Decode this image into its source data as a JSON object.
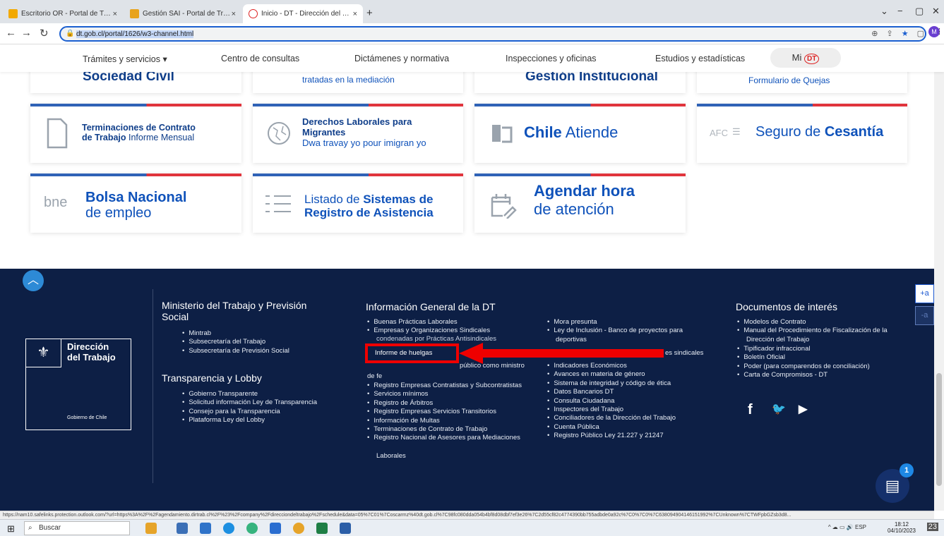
{
  "browser": {
    "tabs": [
      {
        "title": "Escritorio OR - Portal de Transpa",
        "color": "#f2a900"
      },
      {
        "title": "Gestión SAI - Portal de Transpar",
        "color": "#e8a31c"
      },
      {
        "title": "Inicio - DT - Dirección del Trabaj",
        "color": "#d22"
      }
    ],
    "url": "dt.gob.cl/portal/1626/w3-channel.html",
    "profile_initial": "M"
  },
  "topnav": {
    "items": [
      "Trámites y servicios ▾",
      "Centro de consultas",
      "Dictámenes y normativa",
      "Inspecciones y oficinas",
      "Estudios y estadísticas"
    ],
    "mi": "Mi",
    "dt": "DT"
  },
  "cards": {
    "row0": {
      "a": "Sociedad Civil",
      "b": "tratadas en la mediación",
      "c": "Gestión Institucional",
      "d": "Formulario de Quejas"
    },
    "row1": {
      "terminaciones_bold": "Terminaciones de Contrato",
      "terminaciones_bold2": "de Trabajo",
      "terminaciones_rest": " Informe Mensual",
      "derechos_1": "Derechos Laborales para",
      "derechos_2": "Migrantes",
      "derechos_3": "Dwa travay yo pour imigran yo",
      "chile_bold": "Chile",
      "chile_rest": " Atiende",
      "afc": "AFC",
      "seguro_1": "Seguro de ",
      "seguro_2": "Cesantía"
    },
    "row2": {
      "bne": "bne",
      "bolsa_1": "Bolsa Nacional",
      "bolsa_2": "de empleo",
      "listado_1": "Listado de ",
      "listado_2": "Sistemas de",
      "listado_3": "Registro de Asistencia",
      "agendar_1": "Agendar hora",
      "agendar_2": "de atención"
    }
  },
  "footer": {
    "logo_1": "Dirección",
    "logo_2": "del Trabajo",
    "logo_3": "Gobierno de Chile",
    "ministerio_title_1": "Ministerio del Trabajo y Previsión",
    "ministerio_title_2": "Social",
    "ministerio_links": [
      "Mintrab",
      "Subsecretaría del Trabajo",
      "Subsecretaría de Previsión Social"
    ],
    "transparencia_title": "Transparencia y Lobby",
    "transparencia_links": [
      "Gobierno Transparente",
      "Solicitud información Ley de Transparencia",
      "Consejo para la Transparencia",
      "Plataforma Ley del Lobby"
    ],
    "info_title": "Información General de la DT",
    "info_col1": [
      "Buenas Prácticas Laborales",
      "Empresas y Organizaciones Sindicales"
    ],
    "info_col1_hidden": "condenadas por Prácticas Antisindicales",
    "informe": "Informe de huelgas",
    "publico_tail": "público como ministro",
    "de_fe": "de fe",
    "info_col1_rest": [
      "Registro Empresas Contratistas y Subcontratistas",
      "Servicios mínimos",
      "Registro de Árbitros",
      "Registro Empresas Servicios Transitorios",
      "Información de Multas",
      "Terminaciones de Contrato de Trabajo",
      "Registro Nacional de Asesores para Mediaciones"
    ],
    "laborales": "Laborales",
    "info_col2a": [
      "Mora presunta",
      "Ley de Inclusión - Banco de proyectos para"
    ],
    "deportivas": "deportivas",
    "sindicales_tail": "es sindicales",
    "info_col2b": [
      "Indicadores Económicos",
      "Avances en materia de género",
      "Sistema de integridad y código de ética",
      "Datos Bancarios DT",
      "Consulta Ciudadana",
      "Inspectores del Trabajo",
      "Conciliadores de la Dirección del Trabajo",
      "Cuenta Pública",
      "Registro Público Ley 21.227 y 21247"
    ],
    "docs_title": "Documentos de interés",
    "docs_links": [
      "Modelos de Contrato",
      "Manual del Procedimiento de Fiscalización de la",
      "Tipificador infraccional",
      "Boletín Oficial",
      "Poder (para comparendos de conciliación)",
      "Carta de Compromisos - DT"
    ],
    "docs_cont": "Dirección del Trabajo",
    "social": [
      "f",
      "🐦",
      "▶"
    ],
    "chat_badge": "1",
    "access_plus": "+a",
    "access_minus": "-a"
  },
  "status_url": "https://nam10.safelinks.protection.outlook.com/?url=https%3A%2F%2Fagendamiento.dirtrab.cl%2F%23%2Fcompany%2Fdirecciondeltrabajo%2Fschedule&data=05%7C01%7Coscarmz%40dt.gob.cl%7C98fc080dda054b4bf8d08dbf7ef3e26%7C2d55cf82c4774390bb755adbde0a92c%7C0%7C0%7C638094904146151992%7CUnknown%7CTWFpbGZsb3d8...",
  "taskbar": {
    "search": "Buscar",
    "lang": "ESP",
    "time": "18:12",
    "date": "04/10/2023",
    "notif": "23"
  }
}
